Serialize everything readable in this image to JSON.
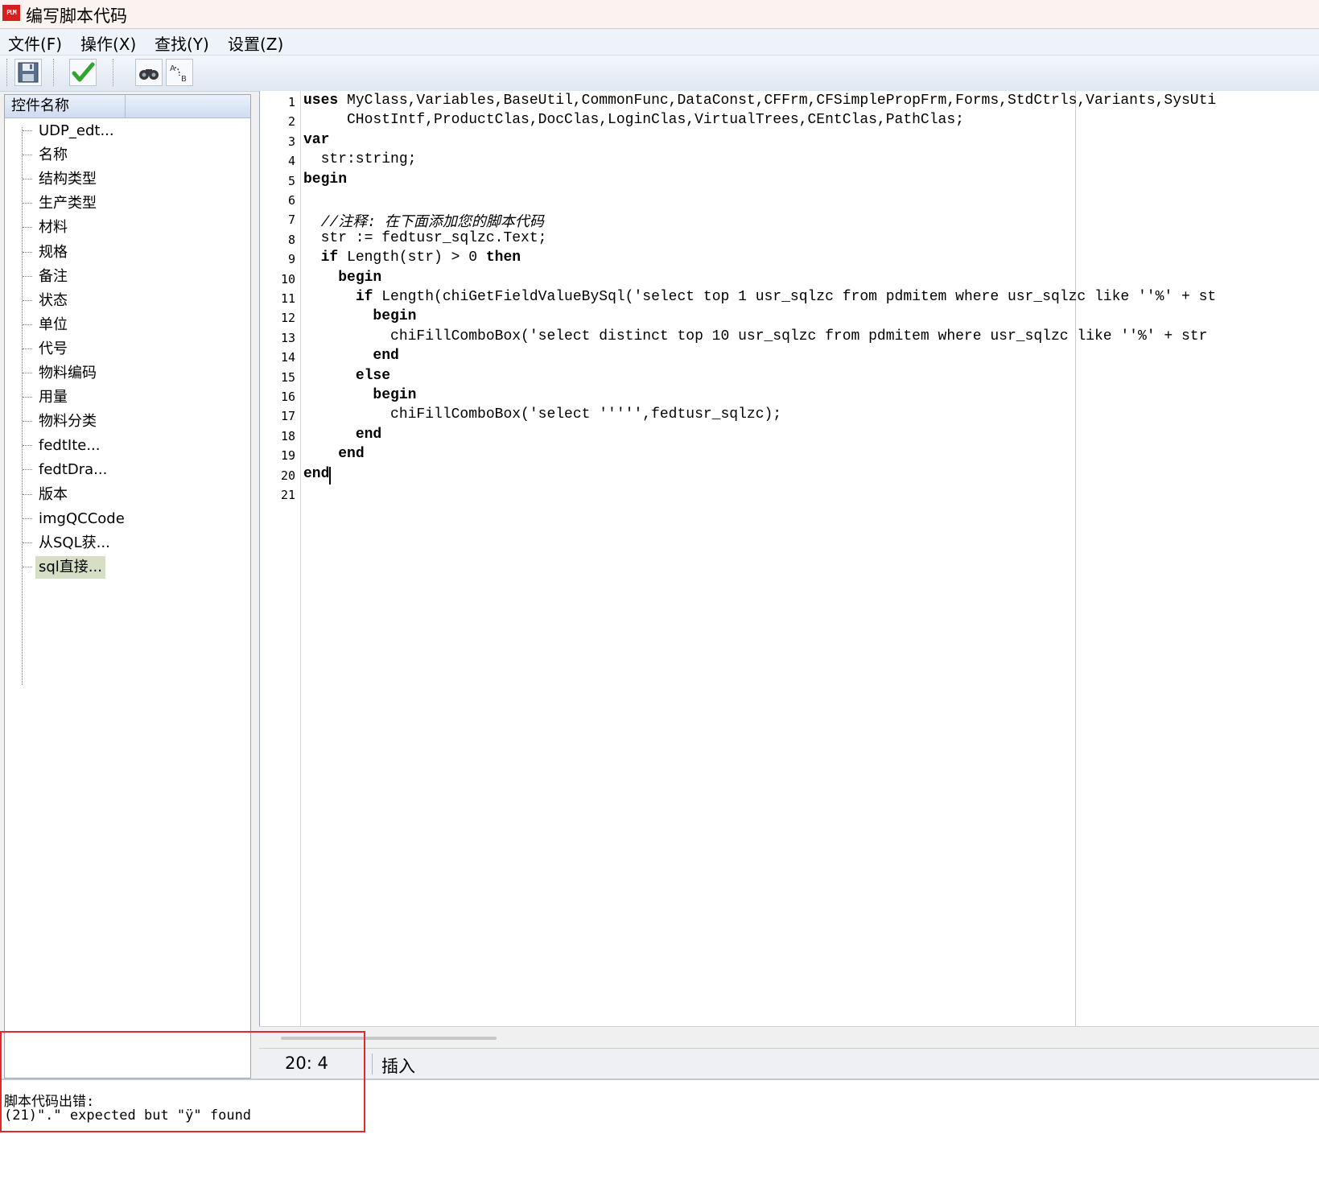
{
  "window": {
    "title": "编写脚本代码",
    "icon_label": "PLM"
  },
  "menu": [
    "文件(F)",
    "操作(X)",
    "查找(Y)",
    "设置(Z)"
  ],
  "toolbar": {
    "buttons": [
      "save-icon",
      "check-icon",
      "binoculars-icon",
      "replace-icon"
    ]
  },
  "tree": {
    "header": "控件名称",
    "items": [
      "UDP_edt...",
      "名称",
      "结构类型",
      "生产类型",
      "材料",
      "规格",
      "备注",
      "状态",
      "单位",
      "代号",
      "物料编码",
      "用量",
      "物料分类",
      "fedtIte...",
      "fedtDra...",
      "版本",
      "imgQCCode",
      "从SQL获...",
      "sql直接..."
    ],
    "selected_index": 18
  },
  "editor": {
    "lines": [
      [
        {
          "t": "uses",
          "k": true
        },
        {
          "t": " MyClass,Variables,BaseUtil,CommonFunc,DataConst,CFFrm,CFSimplePropFrm,Forms,StdCtrls,Variants,SysUti"
        }
      ],
      [
        {
          "t": "     CHostIntf,ProductClas,DocClas,LoginClas,VirtualTrees,CEntClas,PathClas;"
        }
      ],
      [
        {
          "t": "var",
          "k": true
        }
      ],
      [
        {
          "t": "  str:string;"
        }
      ],
      [
        {
          "t": "begin",
          "k": true
        }
      ],
      [],
      [
        {
          "t": "  "
        },
        {
          "t": "//注释: 在下面添加您的脚本代码",
          "c": true
        }
      ],
      [
        {
          "t": "  str := fedtusr_sqlzc.Text;"
        }
      ],
      [
        {
          "t": "  "
        },
        {
          "t": "if",
          "k": true
        },
        {
          "t": " Length(str) > 0 "
        },
        {
          "t": "then",
          "k": true
        }
      ],
      [
        {
          "t": "    "
        },
        {
          "t": "begin",
          "k": true
        }
      ],
      [
        {
          "t": "      "
        },
        {
          "t": "if",
          "k": true
        },
        {
          "t": " Length(chiGetFieldValueBySql('select top 1 usr_sqlzc from pdmitem where usr_sqlzc like ''%' + st"
        }
      ],
      [
        {
          "t": "        "
        },
        {
          "t": "begin",
          "k": true
        }
      ],
      [
        {
          "t": "          chiFillComboBox('select distinct top 10 usr_sqlzc from pdmitem where usr_sqlzc like ''%' + str"
        }
      ],
      [
        {
          "t": "        "
        },
        {
          "t": "end",
          "k": true
        }
      ],
      [
        {
          "t": "      "
        },
        {
          "t": "else",
          "k": true
        }
      ],
      [
        {
          "t": "        "
        },
        {
          "t": "begin",
          "k": true
        }
      ],
      [
        {
          "t": "          chiFillComboBox('select ''''',fedtusr_sqlzc);"
        }
      ],
      [
        {
          "t": "      "
        },
        {
          "t": "end",
          "k": true
        }
      ],
      [
        {
          "t": "    "
        },
        {
          "t": "end",
          "k": true
        }
      ],
      [
        {
          "t": "end",
          "k": true
        }
      ],
      []
    ],
    "caret": {
      "line": 20,
      "col": 4
    }
  },
  "status": {
    "position": "20: 4",
    "mode": "插入"
  },
  "messages": [
    "脚本代码出错:",
    "(21)\".\" expected but \"ÿ\" found"
  ],
  "colors": {
    "highlight_box": "#e0282e",
    "selected_tree_item": "#d6dfc6"
  }
}
